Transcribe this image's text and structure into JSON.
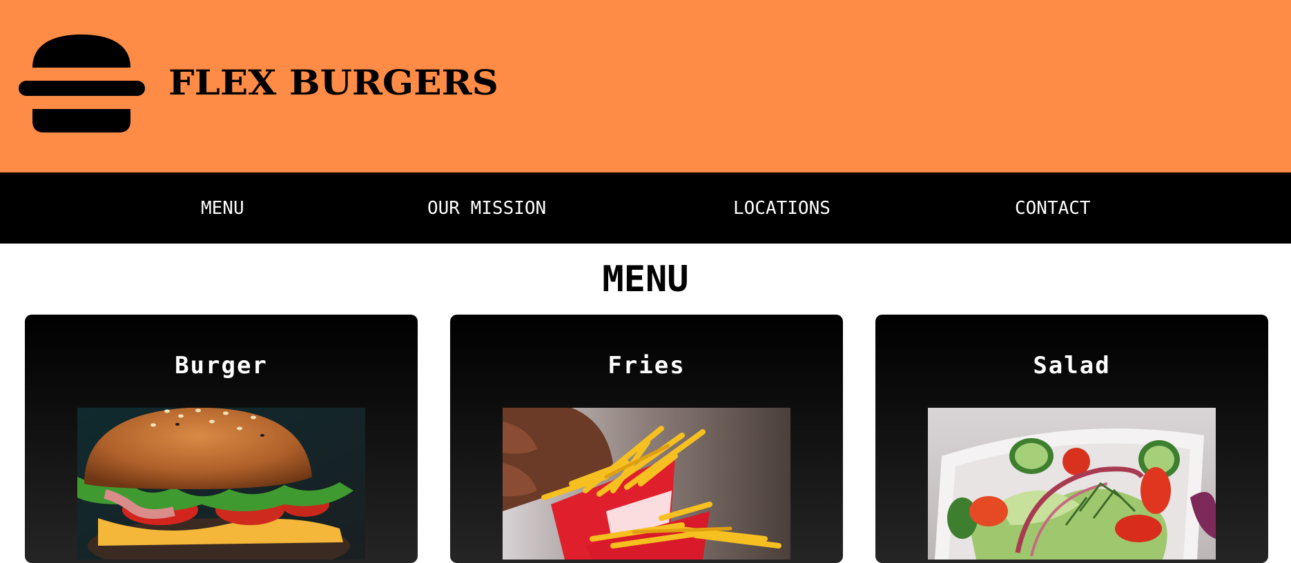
{
  "header": {
    "brand": "FLEX BURGERS",
    "logo_icon": "burger-logo-icon",
    "background_color": "#ff8c46"
  },
  "nav": {
    "items": [
      {
        "label": "MENU"
      },
      {
        "label": "OUR MISSION"
      },
      {
        "label": "LOCATIONS"
      },
      {
        "label": "CONTACT"
      }
    ],
    "background_color": "#000000"
  },
  "main": {
    "title": "MENU",
    "cards": [
      {
        "title": "Burger",
        "image": "burger-photo"
      },
      {
        "title": "Fries",
        "image": "fries-photo"
      },
      {
        "title": "Salad",
        "image": "salad-photo"
      }
    ]
  }
}
